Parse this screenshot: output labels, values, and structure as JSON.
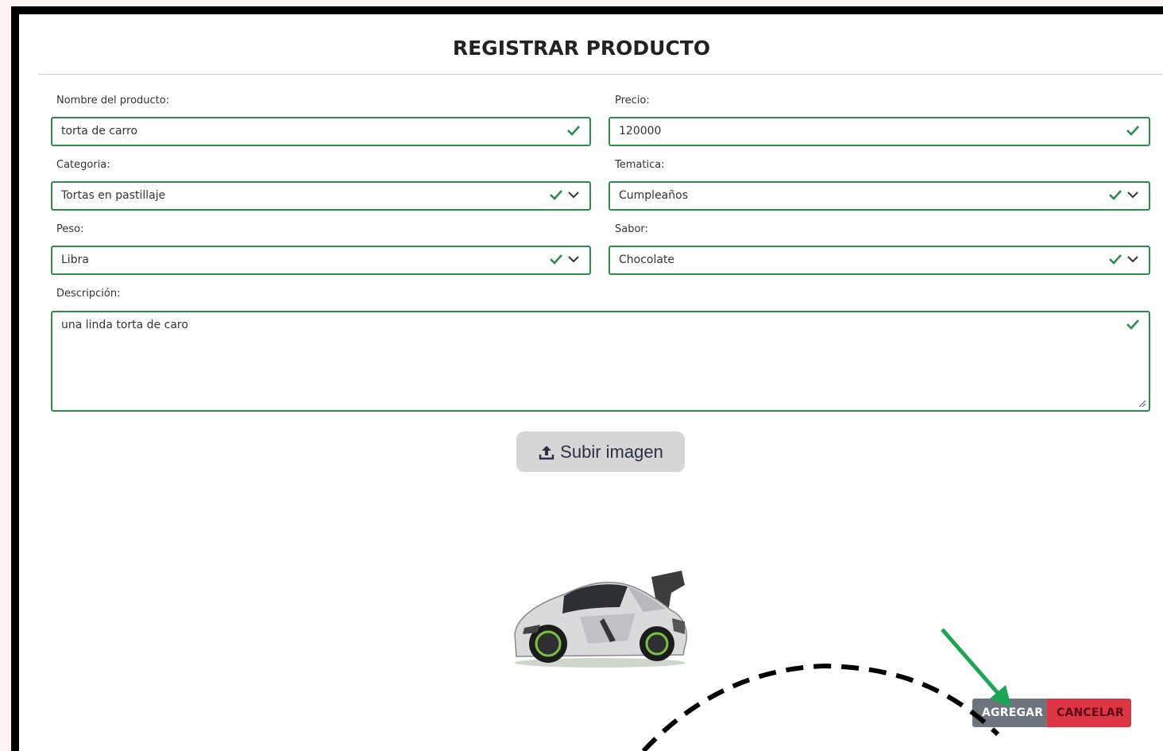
{
  "form": {
    "title": "REGISTRAR PRODUCTO",
    "fields": {
      "nombre": {
        "label": "Nombre del producto:",
        "value": "torta de carro"
      },
      "precio": {
        "label": "Precio:",
        "value": "120000"
      },
      "categoria": {
        "label": "Categoria:",
        "value": "Tortas en pastillaje"
      },
      "tematica": {
        "label": "Tematica:",
        "value": "Cumpleaños"
      },
      "peso": {
        "label": "Peso:",
        "value": "Libra"
      },
      "sabor": {
        "label": "Sabor:",
        "value": "Chocolate"
      },
      "descripcion": {
        "label": "Descripción:",
        "value": "una linda torta de caro"
      }
    },
    "upload_button": {
      "label": "Subir imagen",
      "icon": "upload-icon"
    },
    "buttons": {
      "add": "AGREGAR",
      "cancel": "CANCELAR"
    }
  },
  "colors": {
    "valid_border": "#2f8a4c",
    "add_button": "#6c757d",
    "cancel_button": "#dc3545",
    "annotation_arrow": "#1aa652"
  },
  "icons": [
    "check-icon",
    "chevron-down-icon",
    "upload-icon",
    "resize-handle-icon"
  ]
}
